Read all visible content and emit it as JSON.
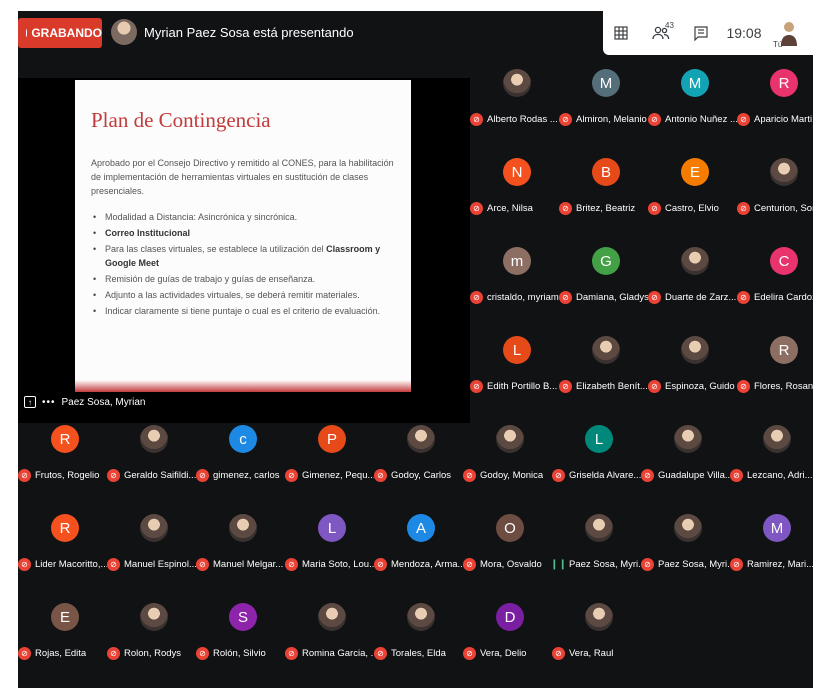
{
  "topbar": {
    "recording_label": "GRABANDO",
    "presenter_text": "Myrian Paez Sosa está presentando",
    "toolbar": {
      "people_count": "43",
      "clock": "19:08",
      "self_label": "Tú"
    }
  },
  "slide": {
    "title": "Plan de Contingencia",
    "intro": "Aprobado por el Consejo Directivo y remitido al CONES, para la habilitación de implementación de herramientas virtuales en sustitución de clases presenciales.",
    "bullets": [
      {
        "text": "Modalidad a Distancia: Asincrónica y sincrónica.",
        "bold": ""
      },
      {
        "text": "",
        "bold": "Correo Institucional"
      },
      {
        "text": "Para las clases virtuales, se establece la utilización del ",
        "bold": "Classroom y Google Meet"
      },
      {
        "text": "Remisión de guías de trabajo y guías de enseñanza.",
        "bold": ""
      },
      {
        "text": "Adjunto a las actividades virtuales, se deberá remitir materiales.",
        "bold": ""
      },
      {
        "text": "Indicar claramente si tiene puntaje o cual es el criterio de evaluación.",
        "bold": ""
      }
    ]
  },
  "presentation_label": "Paez Sosa, Myrian",
  "participants": [
    {
      "name": "Alberto Rodas ...",
      "initial": "",
      "color": "",
      "photo": true
    },
    {
      "name": "Almiron, Melanio",
      "initial": "M",
      "color": "#546e7a",
      "photo": false
    },
    {
      "name": "Antonio Nuñez ...",
      "initial": "M",
      "color": "#12a4b4",
      "photo": false
    },
    {
      "name": "Aparicio Marti...",
      "initial": "R",
      "color": "#e8336d",
      "photo": false
    },
    {
      "name": "Arce, Nilsa",
      "initial": "N",
      "color": "#f4511e",
      "photo": false
    },
    {
      "name": "Britez, Beatriz",
      "initial": "B",
      "color": "#e64a19",
      "photo": false
    },
    {
      "name": "Castro, Elvio",
      "initial": "E",
      "color": "#f57c00",
      "photo": false
    },
    {
      "name": "Centurion, Son...",
      "initial": "",
      "color": "",
      "photo": true
    },
    {
      "name": "cristaldo, myriam",
      "initial": "m",
      "color": "#8d6e63",
      "photo": false
    },
    {
      "name": "Damiana, Gladys",
      "initial": "G",
      "color": "#43a047",
      "photo": false
    },
    {
      "name": "Duarte de Zarz...",
      "initial": "",
      "color": "",
      "photo": true
    },
    {
      "name": "Edelira Cardoz...",
      "initial": "C",
      "color": "#e8336d",
      "photo": false
    },
    {
      "name": "Edith Portillo B...",
      "initial": "L",
      "color": "#e64a19",
      "photo": false
    },
    {
      "name": "Elizabeth Benít...",
      "initial": "",
      "color": "",
      "photo": true
    },
    {
      "name": "Espinoza, Guido",
      "initial": "",
      "color": "",
      "photo": true
    },
    {
      "name": "Flores, Rosana",
      "initial": "R",
      "color": "#8d6e63",
      "photo": false
    },
    {
      "name": "Frutos, Rogelio",
      "initial": "R",
      "color": "#f4511e",
      "photo": false
    },
    {
      "name": "Geraldo Saifildi...",
      "initial": "",
      "color": "",
      "photo": true
    },
    {
      "name": "gimenez, carlos",
      "initial": "c",
      "color": "#1e88e5",
      "photo": false
    },
    {
      "name": "Gimenez, Pequ...",
      "initial": "P",
      "color": "#e64a19",
      "photo": false
    },
    {
      "name": "Godoy, Carlos",
      "initial": "",
      "color": "",
      "photo": true
    },
    {
      "name": "Godoy, Monica",
      "initial": "",
      "color": "",
      "photo": true
    },
    {
      "name": "Griselda Alvare...",
      "initial": "L",
      "color": "#00897b",
      "photo": false
    },
    {
      "name": "Guadalupe Villa...",
      "initial": "",
      "color": "",
      "photo": true
    },
    {
      "name": "Lezcano, Adri...",
      "initial": "",
      "color": "",
      "photo": true
    },
    {
      "name": "Lider Macoritto,...",
      "initial": "R",
      "color": "#f4511e",
      "photo": false
    },
    {
      "name": "Manuel Espinol...",
      "initial": "",
      "color": "",
      "photo": true
    },
    {
      "name": "Manuel Melgar...",
      "initial": "",
      "color": "",
      "photo": true
    },
    {
      "name": "Maria Soto, Lou...",
      "initial": "L",
      "color": "#7e57c2",
      "photo": false
    },
    {
      "name": "Mendoza, Arma...",
      "initial": "A",
      "color": "#1e88e5",
      "photo": false
    },
    {
      "name": "Mora, Osvaldo",
      "initial": "O",
      "color": "#6d4c41",
      "photo": false
    },
    {
      "name": "Paez Sosa, Myri...",
      "initial": "",
      "color": "",
      "photo": true,
      "speaking": true
    },
    {
      "name": "Paez Sosa, Myri...",
      "initial": "",
      "color": "",
      "photo": true
    },
    {
      "name": "Ramirez, Mari...",
      "initial": "M",
      "color": "#7e57c2",
      "photo": false
    },
    {
      "name": "Rojas, Edita",
      "initial": "E",
      "color": "#795548",
      "photo": false
    },
    {
      "name": "Rolon, Rodys",
      "initial": "",
      "color": "",
      "photo": true
    },
    {
      "name": "Rolón, Silvio",
      "initial": "S",
      "color": "#8e24aa",
      "photo": false
    },
    {
      "name": "Romina Garcia, ...",
      "initial": "",
      "color": "",
      "photo": true
    },
    {
      "name": "Torales, Elda",
      "initial": "",
      "color": "",
      "photo": true
    },
    {
      "name": "Vera, Delio",
      "initial": "D",
      "color": "#7b1fa2",
      "photo": false
    },
    {
      "name": "Vera, Raul",
      "initial": "",
      "color": "",
      "photo": true
    }
  ]
}
